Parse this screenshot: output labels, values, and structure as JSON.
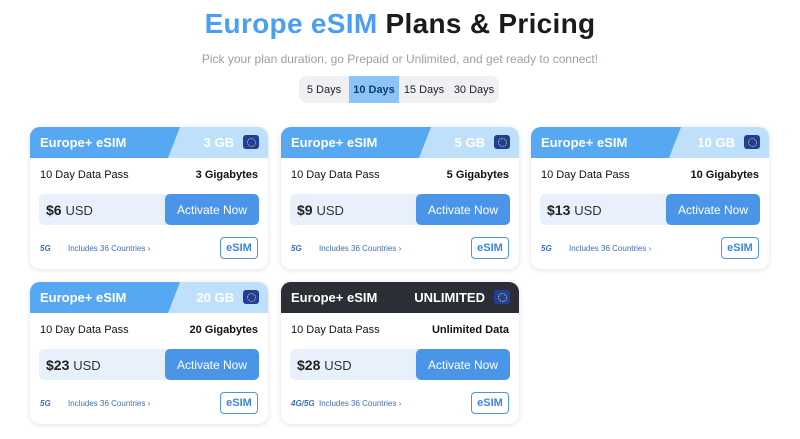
{
  "header": {
    "title_accent": "Europe eSIM",
    "title_rest": " Plans & Pricing",
    "subtitle": "Pick your plan duration, go Prepaid or Unlimited, and get ready to connect!"
  },
  "tabs": [
    {
      "label": "5 Days",
      "active": false
    },
    {
      "label": "10 Days",
      "active": true
    },
    {
      "label": "15 Days",
      "active": false
    },
    {
      "label": "30 Days",
      "active": false
    }
  ],
  "plans": [
    {
      "brand": "Europe+ eSIM",
      "size": "3 GB",
      "pass": "10 Day Data Pass",
      "amount": "3 Gigabytes",
      "price": "$6",
      "currency": "USD",
      "button": "Activate Now",
      "network": "5G",
      "countries": "Includes 36 Countries ›",
      "badge": "eSIM"
    },
    {
      "brand": "Europe+ eSIM",
      "size": "5 GB",
      "pass": "10 Day Data Pass",
      "amount": "5 Gigabytes",
      "price": "$9",
      "currency": "USD",
      "button": "Activate Now",
      "network": "5G",
      "countries": "Includes 36 Countries ›",
      "badge": "eSIM"
    },
    {
      "brand": "Europe+ eSIM",
      "size": "10 GB",
      "pass": "10 Day Data Pass",
      "amount": "10 Gigabytes",
      "price": "$13",
      "currency": "USD",
      "button": "Activate Now",
      "network": "5G",
      "countries": "Includes 36 Countries ›",
      "badge": "eSIM"
    },
    {
      "brand": "Europe+ eSIM",
      "size": "20 GB",
      "pass": "10 Day Data Pass",
      "amount": "20 Gigabytes",
      "price": "$23",
      "currency": "USD",
      "button": "Activate Now",
      "network": "5G",
      "countries": "Includes 36 Countries ›",
      "badge": "eSIM"
    },
    {
      "brand": "Europe+ eSIM",
      "size": "UNLIMITED",
      "pass": "10 Day Data Pass",
      "amount": "Unlimited Data",
      "price": "$28",
      "currency": "USD",
      "button": "Activate Now",
      "network": "4G/5G",
      "countries": "Includes 36 Countries ›",
      "badge": "eSIM"
    }
  ],
  "icons": {
    "flag": "eu-flag-icon"
  },
  "colors": {
    "accent": "#4a9ff5",
    "button": "#4b95e8",
    "dark_header": "#2b2f35"
  }
}
